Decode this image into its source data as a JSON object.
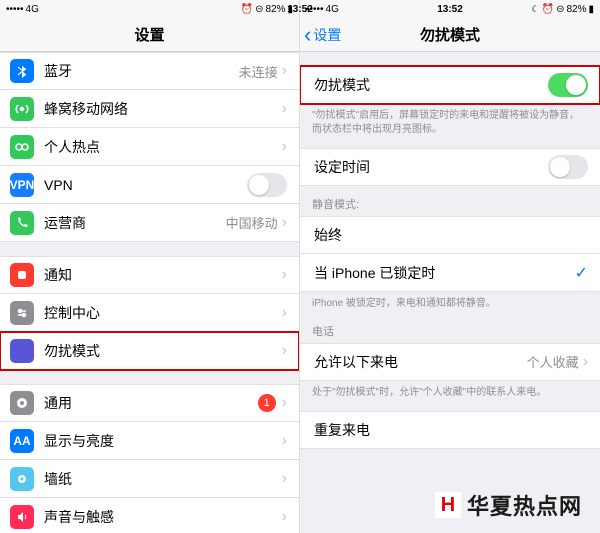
{
  "status": {
    "network": "4G",
    "signal": "•••••",
    "time": "13:52",
    "alarm": "⏰",
    "moon": "☾",
    "lock": "⊝",
    "battery_pct": "82%",
    "battery_icon": "▮"
  },
  "left": {
    "title": "设置",
    "rows": {
      "bluetooth": {
        "label": "蓝牙",
        "value": "未连接"
      },
      "cellular": {
        "label": "蜂窝移动网络"
      },
      "hotspot": {
        "label": "个人热点"
      },
      "vpn": {
        "label": "VPN",
        "icon_text": "VPN"
      },
      "carrier": {
        "label": "运营商",
        "value": "中国移动"
      },
      "notifications": {
        "label": "通知"
      },
      "control_center": {
        "label": "控制中心"
      },
      "dnd": {
        "label": "勿扰模式"
      },
      "general": {
        "label": "通用",
        "badge": "1"
      },
      "display": {
        "label": "显示与亮度",
        "icon_text": "AA"
      },
      "wallpaper": {
        "label": "墙纸"
      },
      "sounds": {
        "label": "声音与触感"
      }
    }
  },
  "right": {
    "back": "设置",
    "title": "勿扰模式",
    "dnd_toggle": {
      "label": "勿扰模式"
    },
    "dnd_note": "\"勿扰模式\"启用后，屏幕锁定时的来电和提醒将被设为静音，而状态栏中将出现月亮图标。",
    "scheduled": {
      "label": "设定时间"
    },
    "silence_header": "静音模式:",
    "always": {
      "label": "始终"
    },
    "locked": {
      "label": "当 iPhone 已锁定时"
    },
    "locked_note": "iPhone 被锁定时，来电和通知都将静音。",
    "phone_header": "电话",
    "allow_calls": {
      "label": "允许以下来电",
      "value": "个人收藏"
    },
    "allow_note": "处于\"勿扰模式\"时，允许\"个人收藏\"中的联系人来电。",
    "repeated": {
      "label": "重复来电"
    }
  },
  "watermark": "华夏热点网"
}
